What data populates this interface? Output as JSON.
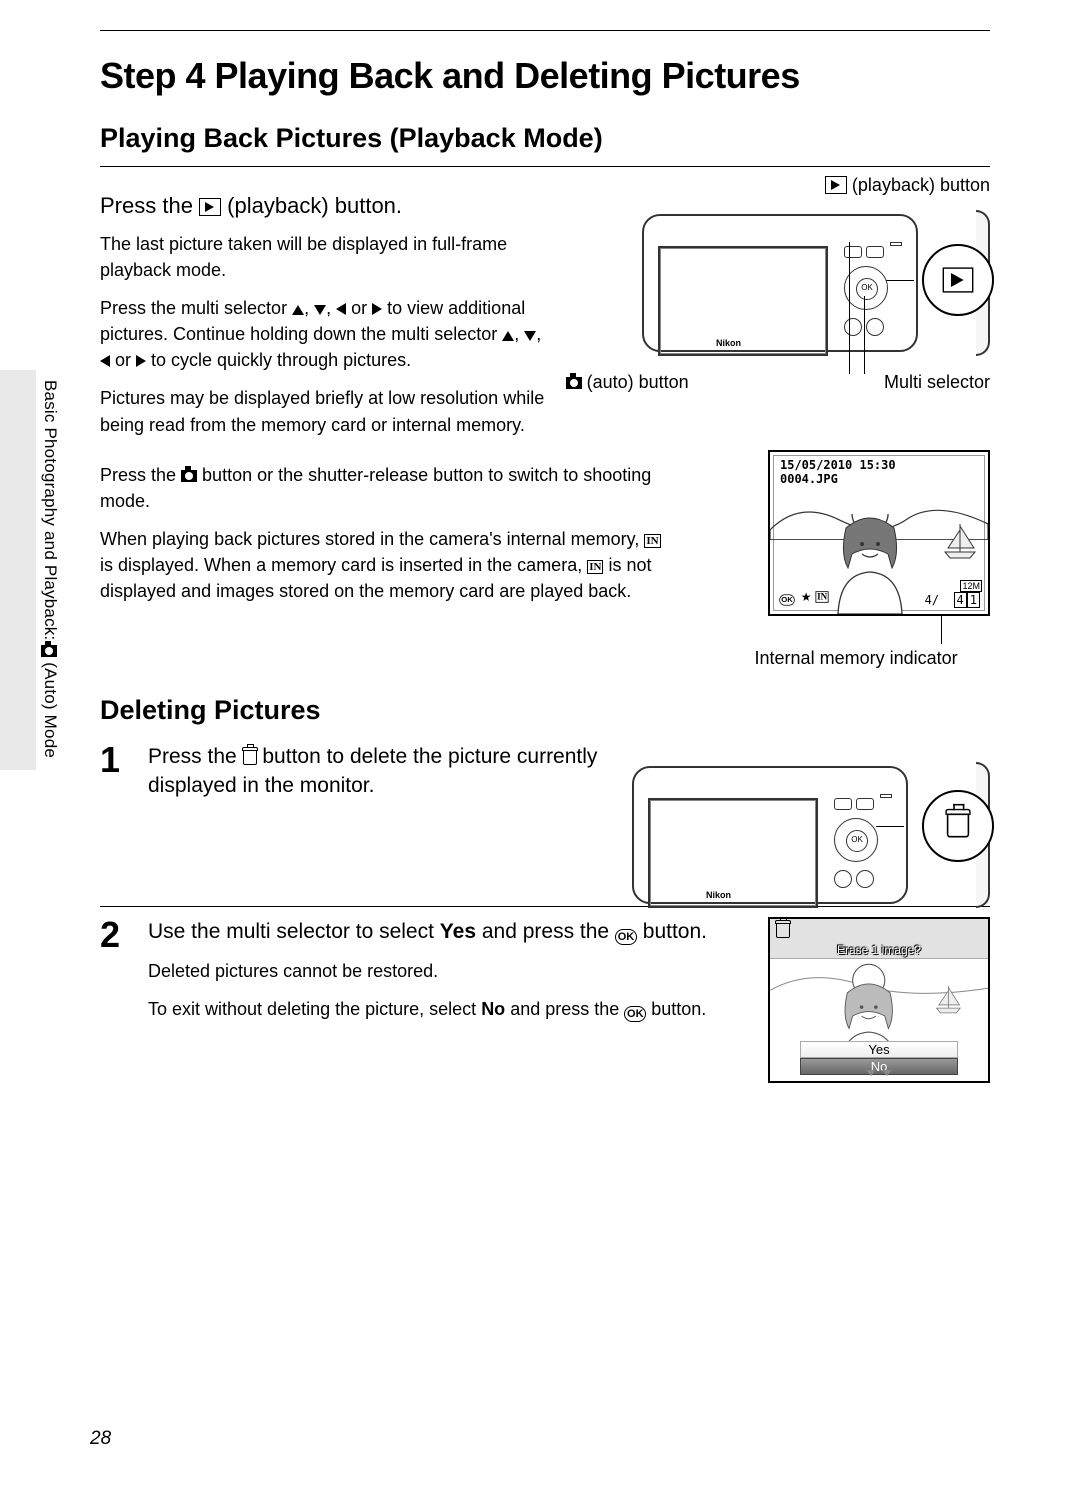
{
  "sidebar_label_prefix": "Basic Photography and Playback: ",
  "sidebar_label_suffix": " (Auto) Mode",
  "page_number": "28",
  "step_title": "Step 4 Playing Back and Deleting Pictures",
  "section1_title": "Playing Back Pictures (Playback Mode)",
  "instr1": {
    "prefix": "Press the ",
    "suffix": " (playback) button."
  },
  "para1": "The last picture taken will be displayed in full-frame playback mode.",
  "para2a": "Press the multi selector ",
  "para2b": " to view additional pictures. Continue holding down the multi selector ",
  "para2c": " to cycle quickly through pictures.",
  "arrow_sep1": ", ",
  "arrow_sep2": ", ",
  "arrow_sep3": " or ",
  "para3": "Pictures may be displayed briefly at low resolution while being read from the memory card or internal memory.",
  "para4a": "Press the ",
  "para4b": " button or the shutter-release button to switch to shooting mode.",
  "para5a": "When playing back pictures stored in the camera's internal memory, ",
  "para5b": " is displayed. When a memory card is inserted in the camera, ",
  "para5c": " is not displayed and images stored on the memory card are played back.",
  "callouts": {
    "playback_button_suffix": " (playback) button",
    "auto_button_suffix": " (auto) button",
    "multi_selector": "Multi selector",
    "internal_memory_indicator": "Internal memory indicator"
  },
  "nikon_logo": "Nikon",
  "dpad_ok": "OK",
  "in_label": "IN",
  "pb_screen": {
    "date": "15/05/2010 15:30",
    "filename": "0004.JPG",
    "count_current": "4",
    "count_sep": "/",
    "count_total": "4",
    "count_box": "1",
    "res_label": "12M"
  },
  "section2_title": "Deleting Pictures",
  "del_step1_num": "1",
  "del_step1a": "Press the ",
  "del_step1b": " button to delete the picture currently displayed in the monitor.",
  "del_step2_num": "2",
  "del_step2a": "Use the multi selector to select ",
  "del_step2_bold1": "Yes",
  "del_step2b": " and press the ",
  "del_step2c": " button.",
  "del_step2_sub1": "Deleted pictures cannot be restored.",
  "del_step2_sub2a": "To exit without deleting the picture, select ",
  "del_step2_sub2_bold": "No",
  "del_step2_sub2b": " and press the ",
  "del_step2_sub2c": " button.",
  "erase_dialog": {
    "question": "Erase 1 image?",
    "yes": "Yes",
    "no": "No"
  }
}
